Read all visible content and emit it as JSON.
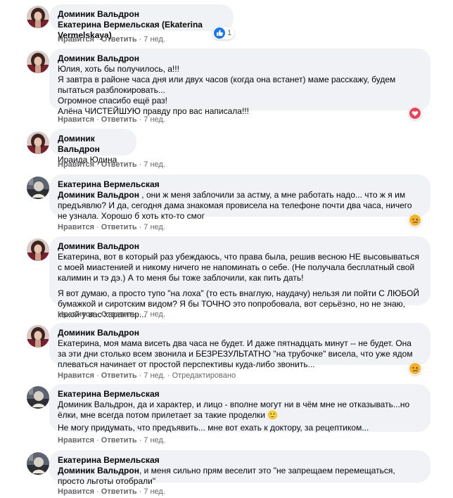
{
  "actions": {
    "like_label": "Нравится",
    "reply_label": "Ответить",
    "separator": "·",
    "edited_label": "Отредактировано"
  },
  "comments": [
    {
      "author": "Доминик Вальдрон",
      "mention": "",
      "text": "Екатерина Вермельская (Ekaterina Vermelskaya)",
      "extra": "",
      "time": "7 нед.",
      "reaction": {
        "type": "like",
        "icon": "like-icon",
        "count": "1",
        "color": "#1877f2"
      }
    },
    {
      "author": "Доминик Вальдрон",
      "mention": "",
      "text": "Юлия, хоть бы получилось, а!!!\nЯ завтра в районе часа дня или двух часов (когда она встанет) маме расскажу, будем пытаться разблокировать...\nОгромное спасибо ещё раз!\nАлёна ЧИСТЕЙШУЮ правду про вас написала!!!",
      "extra": "",
      "time": "7 нед.",
      "reaction": {
        "type": "love",
        "icon": "heart-icon",
        "count": "",
        "color": "#f33e58"
      }
    },
    {
      "author": "Доминик Вальдрон",
      "mention": "",
      "text": "Ираида Юдина",
      "extra": "",
      "time": "7 нед."
    },
    {
      "author": "Екатерина Вермельская",
      "mention": "Доминик Вальдрон",
      "text": " , они ж меня заблочили за астму, а мне работать надо... что ж я им предъявлю? И да, сегодня дама знакомая провисела на телефоне почти два часа, ничего не узнала. Хорошо б хоть кто-то смог",
      "extra": "",
      "time": "7 нед.",
      "reaction": {
        "type": "sad",
        "icon": "sad-face-icon",
        "count": "",
        "color": "#f7b125"
      }
    },
    {
      "author": "Доминик Вальдрон",
      "mention": "",
      "text": "Екатерина, вот в который раз убеждаюсь, что права была, решив весною НЕ высовываться с моей миастенией и никому ничего не напоминать о себе. (Не получала бесплатный свой калимин и тэ дэ.) А то меня бы тоже заблочили, как пить дать!",
      "extra": "Я вот думаю, а просто тупо \"на лоха\" (то есть внаглую, наудачу) нельзя ли пойти С ЛЮБОЙ бумажкой и сиротским видом? Я бы ТОЧНО это попробовала, вот серьёзно, но не знаю, какой у вас характер...",
      "time": "7 нед."
    },
    {
      "author": "Доминик Вальдрон",
      "mention": "",
      "text": "Екатерина, моя мама висеть два часа не будет. И даже пятнадцать минут -- не будет. Она за эти дни столько всем звонила и БЕЗРЕЗУЛЬТАТНО \"на трубочке\" висела, что уже ядом плеваться начинает от простой перспективы куда-либо звонить...",
      "extra": "",
      "time": "7 нед.",
      "edited": true,
      "reaction": {
        "type": "sad",
        "icon": "sad-face-icon",
        "count": "",
        "color": "#f7b125"
      }
    },
    {
      "author": "Екатерина Вермельская",
      "mention": "Доминик Вальдрон",
      "text": ", да и характер, и лицо - вполне могут ни в чём мне не отказывать...но ёлки, мне всегда потом прилетает за такие проделки 🙂",
      "extra": "Не могу придумать, что предъявить... мне вот ехать к доктору, за рецептиком...",
      "time": "7 нед."
    },
    {
      "author": "Екатерина Вермельская",
      "mention": "Доминик Вальдрон",
      "text": ", и меня сильно прям веселит это \"не запрещаем перемещаться, просто льготы отобрали\"",
      "extra": "",
      "time": "7 нед."
    }
  ],
  "colors": {
    "bubble_bg": "#f0f2f5",
    "secondary_text": "#65676b",
    "like_blue": "#1877f2"
  }
}
